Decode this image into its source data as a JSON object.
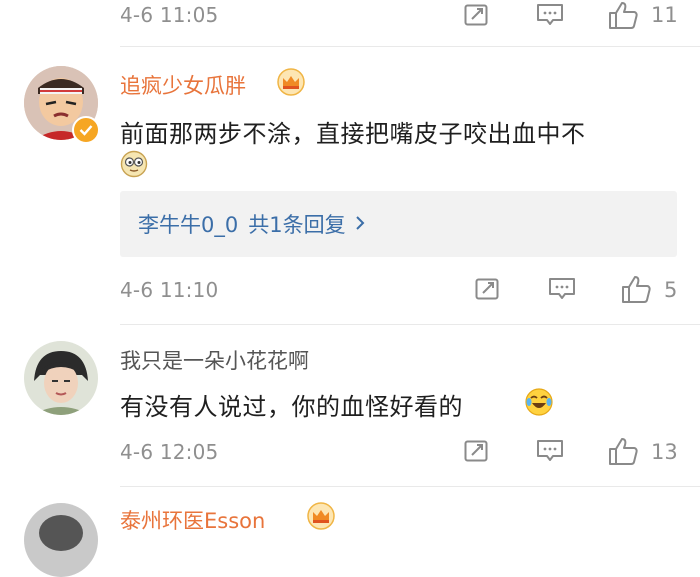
{
  "colors": {
    "username_orange": "#e8743b",
    "username_gray": "#555555",
    "link_blue": "#3b6ea8",
    "meta_gray": "#8f8f8f"
  },
  "comments": [
    {
      "time": "4-6 11:05",
      "likes": "11"
    },
    {
      "username": "追疯少女瓜胖",
      "badge_icon": "crown-vip-icon",
      "verified_icon": "verified-badge-icon",
      "text": "前面那两步不涂，直接把嘴皮子咬出血中不",
      "emoji": "doge-emoji",
      "reply_user": "李牛牛0_0",
      "reply_summary": "共1条回复",
      "time": "4-6 11:10",
      "likes": "5"
    },
    {
      "username": "我只是一朵小花花啊",
      "text": "有没有人说过，你的血怪好看的",
      "emoji": "laugh-cry-emoji",
      "time": "4-6 12:05",
      "likes": "13"
    },
    {
      "username": "泰州环医Esson",
      "badge_icon": "crown-vip-icon"
    }
  ]
}
